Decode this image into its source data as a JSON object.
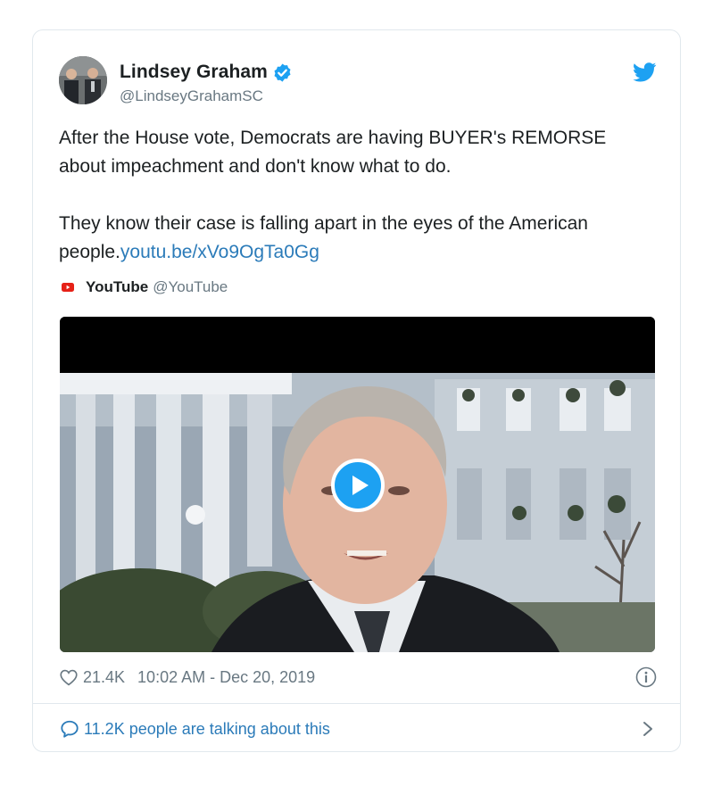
{
  "tweet": {
    "author": {
      "name": "Lindsey Graham",
      "handle": "@LindseyGrahamSC",
      "verified": true,
      "avatar_icon": "profile-photo"
    },
    "text_paragraph_1": "After the House vote, Democrats are having BUYER's REMORSE about impeachment and don't know what to do.",
    "text_paragraph_2_prefix": "They know their case is falling apart in the eyes of the American people.",
    "link": "youtu.be/xVo9OgTa0Gg",
    "source": {
      "name": "YouTube",
      "handle": "@YouTube",
      "icon": "youtube-icon"
    },
    "media": {
      "type": "video",
      "play_icon": "play-icon"
    },
    "likes": "21.4K",
    "timestamp": "10:02 AM - Dec 20, 2019",
    "conversation": "11.2K people are talking about this"
  },
  "colors": {
    "twitter_blue": "#1da1f2",
    "link_blue": "#2b7bb9",
    "text": "#1c2022",
    "muted": "#697882",
    "border": "#e1e8ed",
    "youtube_red": "#e62117"
  }
}
